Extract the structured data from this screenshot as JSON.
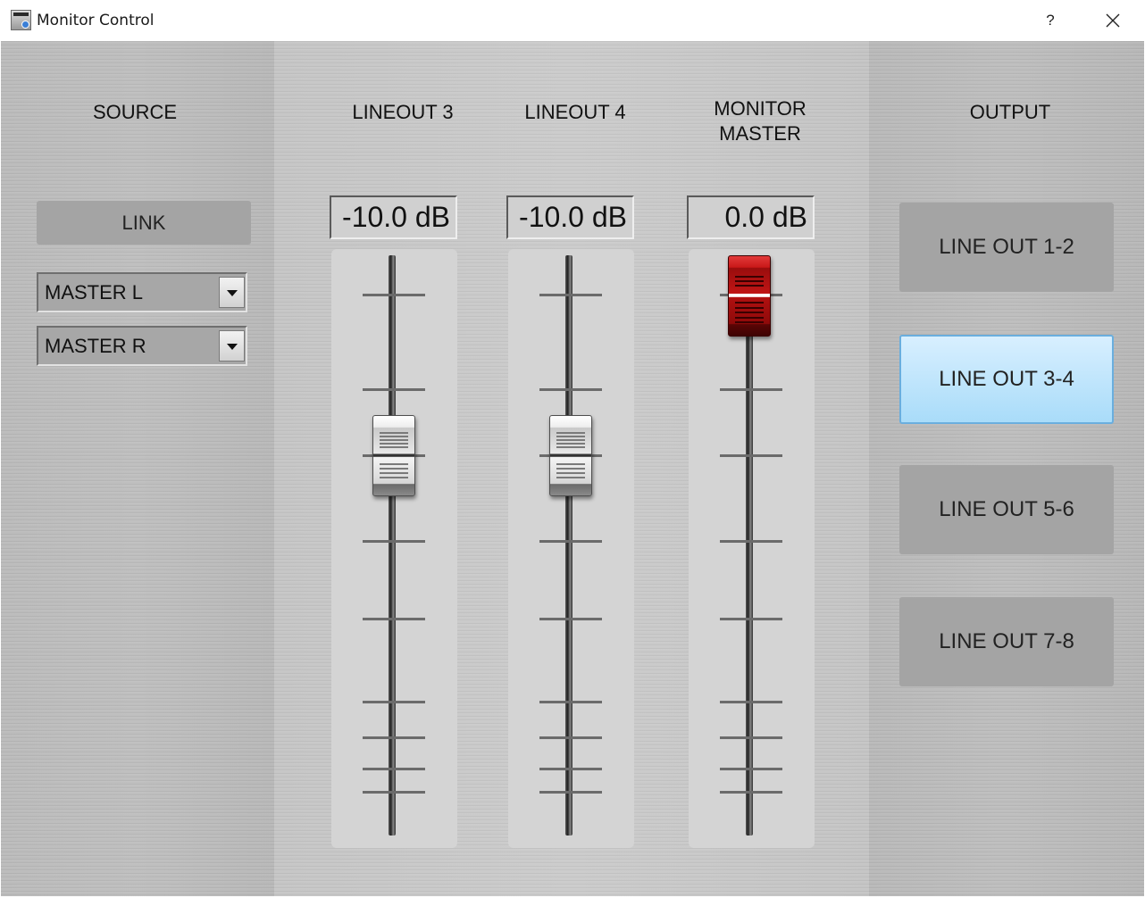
{
  "window": {
    "title": "Monitor Control",
    "help_label": "?",
    "app_icon": "tascam-app-icon",
    "close_icon": "close-icon"
  },
  "source": {
    "header": "SOURCE",
    "link_label": "LINK",
    "select_left": "MASTER L",
    "select_right": "MASTER R"
  },
  "faders": [
    {
      "header": "LINEOUT 3",
      "value": "-10.0 dB",
      "position": 0.35,
      "color": "#d9d9d9"
    },
    {
      "header": "LINEOUT 4",
      "value": "-10.0 dB",
      "position": 0.35,
      "color": "#d9d9d9"
    },
    {
      "header_line1": "MONITOR",
      "header_line2": "MASTER",
      "value": "0.0 dB",
      "position": 0.0,
      "color": "#c01515"
    }
  ],
  "output": {
    "header": "OUTPUT",
    "buttons": [
      "LINE OUT 1-2",
      "LINE OUT 3-4",
      "LINE OUT 5-6",
      "LINE OUT 7-8"
    ],
    "selected": "LINE OUT 3-4",
    "selected_color": "#b4e1fb"
  }
}
